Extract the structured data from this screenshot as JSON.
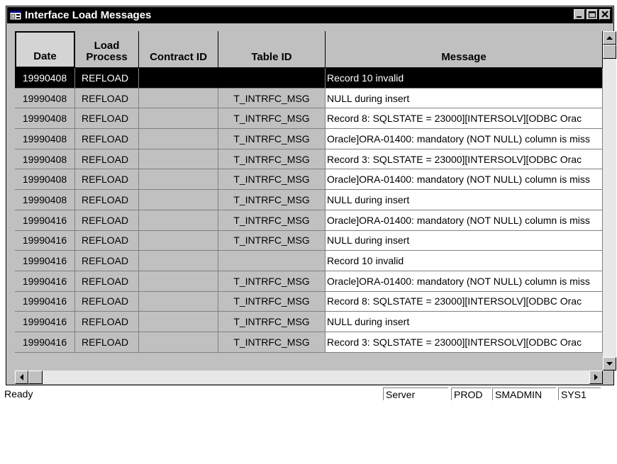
{
  "window": {
    "title": "Interface Load Messages"
  },
  "columns": [
    "Date",
    "Load Process",
    "Contract ID",
    "Table ID",
    "Message"
  ],
  "rows": [
    {
      "date": "19990408",
      "process": "REFLOAD",
      "contract": "",
      "table": "",
      "message": "Record 10 invalid"
    },
    {
      "date": "19990408",
      "process": "REFLOAD",
      "contract": "",
      "table": "T_INTRFC_MSG",
      "message": "NULL during insert"
    },
    {
      "date": "19990408",
      "process": "REFLOAD",
      "contract": "",
      "table": "T_INTRFC_MSG",
      "message": "Record 8: SQLSTATE = 23000][INTERSOLV][ODBC Orac"
    },
    {
      "date": "19990408",
      "process": "REFLOAD",
      "contract": "",
      "table": "T_INTRFC_MSG",
      "message": "Oracle]ORA-01400: mandatory (NOT NULL) column is miss"
    },
    {
      "date": "19990408",
      "process": "REFLOAD",
      "contract": "",
      "table": "T_INTRFC_MSG",
      "message": "Record 3: SQLSTATE = 23000][INTERSOLV][ODBC Orac"
    },
    {
      "date": "19990408",
      "process": "REFLOAD",
      "contract": "",
      "table": "T_INTRFC_MSG",
      "message": "Oracle]ORA-01400: mandatory (NOT NULL) column is miss"
    },
    {
      "date": "19990408",
      "process": "REFLOAD",
      "contract": "",
      "table": "T_INTRFC_MSG",
      "message": "NULL during insert"
    },
    {
      "date": "19990416",
      "process": "REFLOAD",
      "contract": "",
      "table": "T_INTRFC_MSG",
      "message": "Oracle]ORA-01400: mandatory (NOT NULL) column is miss"
    },
    {
      "date": "19990416",
      "process": "REFLOAD",
      "contract": "",
      "table": "T_INTRFC_MSG",
      "message": "NULL during insert"
    },
    {
      "date": "19990416",
      "process": "REFLOAD",
      "contract": "",
      "table": "",
      "message": "Record 10 invalid"
    },
    {
      "date": "19990416",
      "process": "REFLOAD",
      "contract": "",
      "table": "T_INTRFC_MSG",
      "message": "Oracle]ORA-01400: mandatory (NOT NULL) column is miss"
    },
    {
      "date": "19990416",
      "process": "REFLOAD",
      "contract": "",
      "table": "T_INTRFC_MSG",
      "message": "Record 8: SQLSTATE = 23000][INTERSOLV][ODBC Orac"
    },
    {
      "date": "19990416",
      "process": "REFLOAD",
      "contract": "",
      "table": "T_INTRFC_MSG",
      "message": "NULL during insert"
    },
    {
      "date": "19990416",
      "process": "REFLOAD",
      "contract": "",
      "table": "T_INTRFC_MSG",
      "message": "Record 3: SQLSTATE = 23000][INTERSOLV][ODBC Orac"
    }
  ],
  "selected_row": 0,
  "status": {
    "text": "Ready",
    "panes": [
      "Server",
      "PROD",
      "SMADMIN",
      "SYS1"
    ]
  }
}
